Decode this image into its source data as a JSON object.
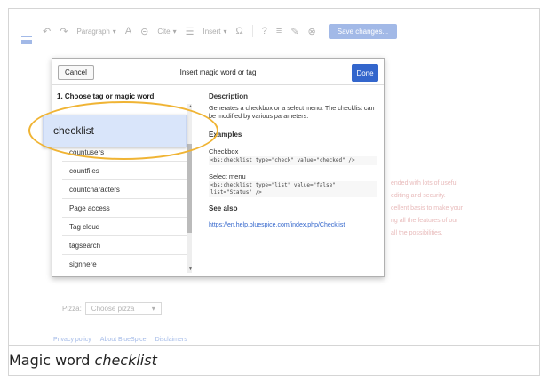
{
  "toolbar": {
    "undo_icon": "undo-icon",
    "redo_icon": "redo-icon",
    "paragraph": "Paragraph",
    "text_style_icon": "A",
    "link_icon": "link-icon",
    "cite": "Cite",
    "list_icon": "list-icon",
    "insert": "Insert",
    "special_char": "Ω",
    "help": "?",
    "save_changes": "Save changes..."
  },
  "dialog": {
    "cancel": "Cancel",
    "title": "Insert magic word or tag",
    "done": "Done",
    "left_title": "1. Choose tag or magic word",
    "items": [
      "countusers",
      "countfiles",
      "countcharacters",
      "Page access",
      "Tag cloud",
      "tagsearch",
      "signhere"
    ],
    "description_title": "Description",
    "description": "Generates a checkbox or a select menu. The checklist can be modified by various parameters.",
    "examples_title": "Examples",
    "checkbox_label": "Checkbox",
    "checkbox_code": "<bs:checklist type=\"check\" value=\"checked\" />",
    "select_label": "Select menu",
    "select_code": "<bs:checklist type=\"list\" value=\"false\" list=\"Status\" />",
    "see_also_title": "See also",
    "see_also_link": "https://en.help.bluespice.com/index.php/Checklist"
  },
  "highlight": {
    "label": "checklist"
  },
  "page": {
    "lines": [
      "ended with lots of useful",
      "editing and security.",
      "cellent basis to make your",
      "ng all the features of our",
      "all the possibilities."
    ],
    "pizza_label": "Pizza:",
    "pizza_select": "Choose pizza",
    "footer": [
      "Privacy policy",
      "About BlueSpice",
      "Disclaimers"
    ]
  },
  "caption": {
    "prefix": "Magic word ",
    "word": "checklist"
  }
}
